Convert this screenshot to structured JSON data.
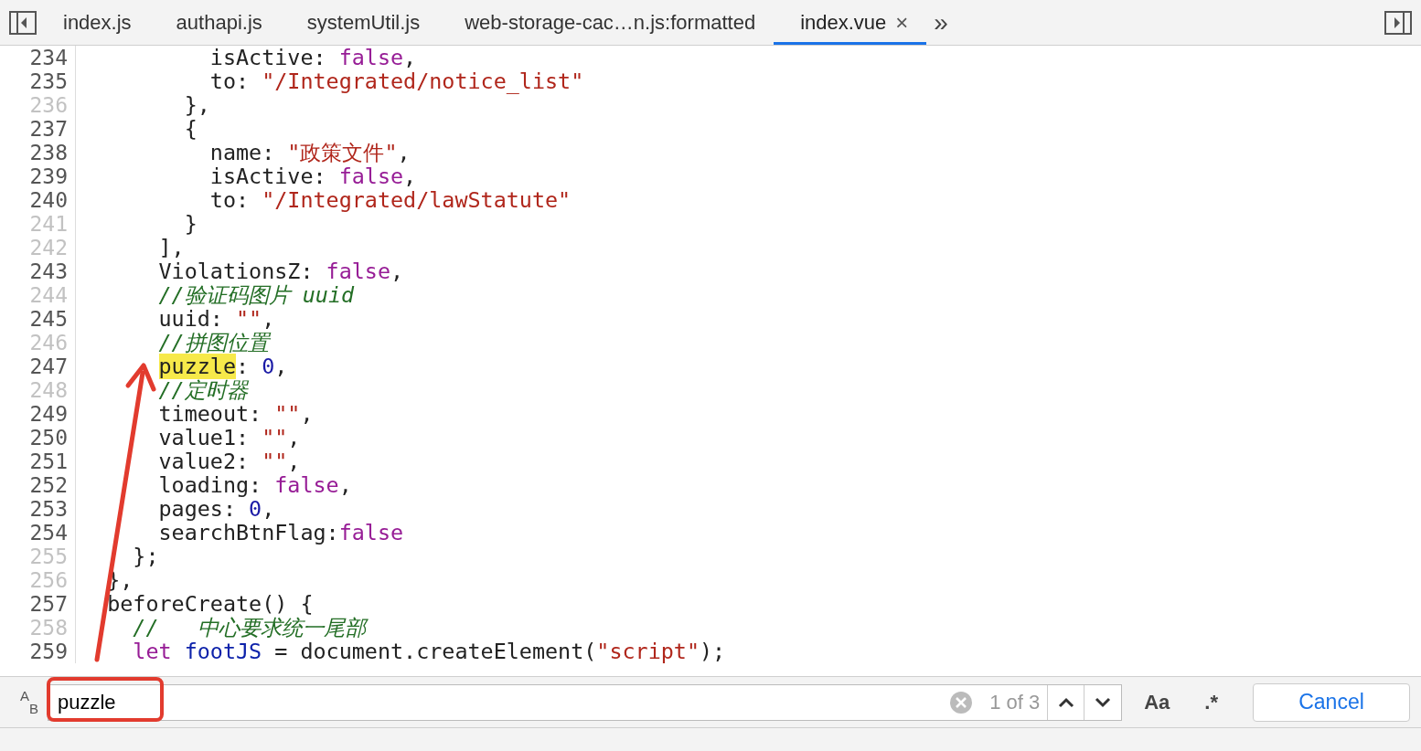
{
  "tabs": [
    {
      "label": "index.js",
      "selected": false,
      "closable": false
    },
    {
      "label": "authapi.js",
      "selected": false,
      "closable": false
    },
    {
      "label": "systemUtil.js",
      "selected": false,
      "closable": false
    },
    {
      "label": "web-storage-cac…n.js:formatted",
      "selected": false,
      "closable": false
    },
    {
      "label": "index.vue",
      "selected": true,
      "closable": true
    }
  ],
  "tab_close": "×",
  "tab_overflow": "»",
  "code_lines": [
    {
      "number": "234",
      "dim": false,
      "tokens": [
        {
          "kind": "plain",
          "text": "          isActive: "
        },
        {
          "kind": "keyword",
          "text": "false"
        },
        {
          "kind": "plain",
          "text": ","
        }
      ]
    },
    {
      "number": "235",
      "dim": false,
      "tokens": [
        {
          "kind": "plain",
          "text": "          to: "
        },
        {
          "kind": "string",
          "text": "\"/Integrated/notice_list\""
        }
      ]
    },
    {
      "number": "236",
      "dim": true,
      "tokens": [
        {
          "kind": "plain",
          "text": "        },"
        }
      ]
    },
    {
      "number": "237",
      "dim": false,
      "tokens": [
        {
          "kind": "plain",
          "text": "        {"
        }
      ]
    },
    {
      "number": "238",
      "dim": false,
      "tokens": [
        {
          "kind": "plain",
          "text": "          name: "
        },
        {
          "kind": "string",
          "text": "\"政策文件\""
        },
        {
          "kind": "plain",
          "text": ","
        }
      ]
    },
    {
      "number": "239",
      "dim": false,
      "tokens": [
        {
          "kind": "plain",
          "text": "          isActive: "
        },
        {
          "kind": "keyword",
          "text": "false"
        },
        {
          "kind": "plain",
          "text": ","
        }
      ]
    },
    {
      "number": "240",
      "dim": false,
      "tokens": [
        {
          "kind": "plain",
          "text": "          to: "
        },
        {
          "kind": "string",
          "text": "\"/Integrated/lawStatute\""
        }
      ]
    },
    {
      "number": "241",
      "dim": true,
      "tokens": [
        {
          "kind": "plain",
          "text": "        }"
        }
      ]
    },
    {
      "number": "242",
      "dim": true,
      "tokens": [
        {
          "kind": "plain",
          "text": "      ],"
        }
      ]
    },
    {
      "number": "243",
      "dim": false,
      "tokens": [
        {
          "kind": "plain",
          "text": "      ViolationsZ: "
        },
        {
          "kind": "keyword",
          "text": "false"
        },
        {
          "kind": "plain",
          "text": ","
        }
      ]
    },
    {
      "number": "244",
      "dim": true,
      "tokens": [
        {
          "kind": "comment",
          "text": "      //验证码图片 uuid"
        }
      ]
    },
    {
      "number": "245",
      "dim": false,
      "tokens": [
        {
          "kind": "plain",
          "text": "      uuid: "
        },
        {
          "kind": "string",
          "text": "\"\""
        },
        {
          "kind": "plain",
          "text": ","
        }
      ]
    },
    {
      "number": "246",
      "dim": true,
      "tokens": [
        {
          "kind": "comment",
          "text": "      //拼图位置"
        }
      ]
    },
    {
      "number": "247",
      "dim": false,
      "tokens": [
        {
          "kind": "match",
          "text": "      puzzle"
        },
        {
          "kind": "plain",
          "text": ": "
        },
        {
          "kind": "number",
          "text": "0"
        },
        {
          "kind": "plain",
          "text": ","
        }
      ]
    },
    {
      "number": "248",
      "dim": true,
      "tokens": [
        {
          "kind": "comment",
          "text": "      //定时器"
        }
      ]
    },
    {
      "number": "249",
      "dim": false,
      "tokens": [
        {
          "kind": "plain",
          "text": "      timeout: "
        },
        {
          "kind": "string",
          "text": "\"\""
        },
        {
          "kind": "plain",
          "text": ","
        }
      ]
    },
    {
      "number": "250",
      "dim": false,
      "tokens": [
        {
          "kind": "plain",
          "text": "      value1: "
        },
        {
          "kind": "string",
          "text": "\"\""
        },
        {
          "kind": "plain",
          "text": ","
        }
      ]
    },
    {
      "number": "251",
      "dim": false,
      "tokens": [
        {
          "kind": "plain",
          "text": "      value2: "
        },
        {
          "kind": "string",
          "text": "\"\""
        },
        {
          "kind": "plain",
          "text": ","
        }
      ]
    },
    {
      "number": "252",
      "dim": false,
      "tokens": [
        {
          "kind": "plain",
          "text": "      loading: "
        },
        {
          "kind": "keyword",
          "text": "false"
        },
        {
          "kind": "plain",
          "text": ","
        }
      ]
    },
    {
      "number": "253",
      "dim": false,
      "tokens": [
        {
          "kind": "plain",
          "text": "      pages: "
        },
        {
          "kind": "number",
          "text": "0"
        },
        {
          "kind": "plain",
          "text": ","
        }
      ]
    },
    {
      "number": "254",
      "dim": false,
      "tokens": [
        {
          "kind": "plain",
          "text": "      searchBtnFlag:"
        },
        {
          "kind": "keyword",
          "text": "false"
        }
      ]
    },
    {
      "number": "255",
      "dim": true,
      "tokens": [
        {
          "kind": "plain",
          "text": "    };"
        }
      ]
    },
    {
      "number": "256",
      "dim": true,
      "tokens": [
        {
          "kind": "plain",
          "text": "  },"
        }
      ]
    },
    {
      "number": "257",
      "dim": false,
      "tokens": [
        {
          "kind": "plain",
          "text": "  beforeCreate() {"
        }
      ]
    },
    {
      "number": "258",
      "dim": true,
      "tokens": [
        {
          "kind": "comment",
          "text": "    //   中心要求统一尾部"
        }
      ]
    },
    {
      "number": "259",
      "dim": false,
      "tokens": [
        {
          "kind": "keyword",
          "text": "    let"
        },
        {
          "kind": "variable",
          "text": " footJS"
        },
        {
          "kind": "plain",
          "text": " = document.createElement("
        },
        {
          "kind": "string",
          "text": "\"script\""
        },
        {
          "kind": "plain",
          "text": ");"
        }
      ]
    }
  ],
  "search": {
    "replace_toggle_top": "A",
    "replace_toggle_bottom": "B",
    "value": "puzzle",
    "match_count": "1 of 3",
    "case_toggle": "Aa",
    "regex_toggle": ".*",
    "cancel": "Cancel"
  }
}
